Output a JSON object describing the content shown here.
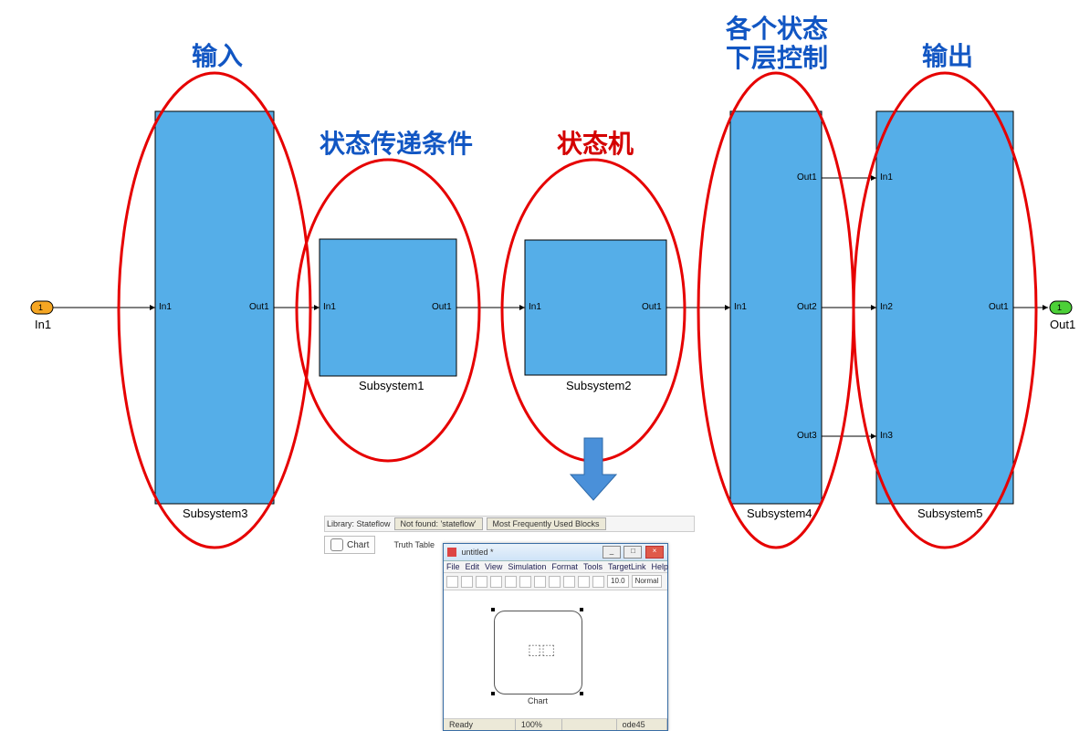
{
  "annotations": {
    "input": "输入",
    "transition": "状态传递条件",
    "state_machine": "状态机",
    "lower_control_line1": "各个状态",
    "lower_control_line2": "下层控制",
    "output": "输出"
  },
  "inport": {
    "label": "In1",
    "num": "1"
  },
  "outport": {
    "label": "Out1",
    "num": "1"
  },
  "blocks": {
    "subsystem3": {
      "name": "Subsystem3",
      "ports_in": [
        "In1"
      ],
      "ports_out": [
        "Out1"
      ]
    },
    "subsystem1": {
      "name": "Subsystem1",
      "ports_in": [
        "In1"
      ],
      "ports_out": [
        "Out1"
      ]
    },
    "subsystem2": {
      "name": "Subsystem2",
      "ports_in": [
        "In1"
      ],
      "ports_out": [
        "Out1"
      ]
    },
    "subsystem4": {
      "name": "Subsystem4",
      "ports_in": [
        "In1"
      ],
      "ports_out": [
        "Out1",
        "Out2",
        "Out3"
      ]
    },
    "subsystem5": {
      "name": "Subsystem5",
      "ports_in": [
        "In1",
        "In2",
        "In3"
      ],
      "ports_out": [
        "Out1"
      ]
    }
  },
  "inset": {
    "library_label": "Library: Stateflow",
    "tab_notfound": "Not found: 'stateflow'",
    "tab_mostused": "Most Frequently Used Blocks",
    "chart_button": "Chart",
    "truthtable_button": "Truth Table",
    "window_title": "untitled *",
    "menus": [
      "File",
      "Edit",
      "View",
      "Simulation",
      "Format",
      "Tools",
      "TargetLink",
      "Help"
    ],
    "toolbar_time": "10.0",
    "toolbar_mode": "Normal",
    "canvas_chart_label": "Chart",
    "status_ready": "Ready",
    "status_zoom": "100%",
    "status_solver": "ode45"
  }
}
